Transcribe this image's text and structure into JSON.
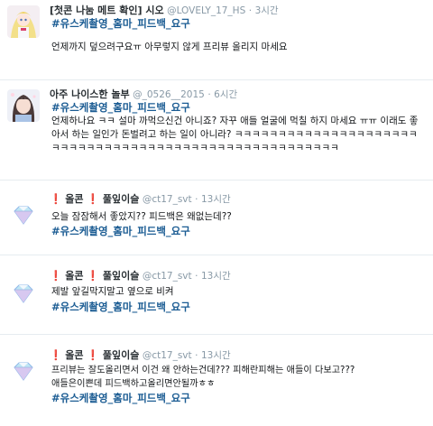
{
  "tweets": [
    {
      "name": "[첫콘 나눔 메트 확인] 시오",
      "handle": "@LOVELY_17_HS",
      "dot": "·",
      "time": "3시간",
      "hashtag": "#유스케촬영_홈마_피드백_요구",
      "text": "언제까지 덮으려구요ㅠ 아무렇지 않게 프리뷰 올리지 마세요"
    },
    {
      "name": "아주 나이스한 놀부",
      "handle": "@_0526__2015",
      "dot": "·",
      "time": "6시간",
      "hashtag": "#유스케촬영_홈마_피드백_요구",
      "text": "언제하나요 ㅋㅋ 설마 까먹으신건 아니죠? 자꾸 애들 얼굴에 먹칠 하지 마세요 ㅠㅠ 이래도 좋아서 하는 일인가 돈벌려고 하는 일이 아니라? ㅋㅋㅋㅋㅋㅋㅋㅋㅋㅋㅋㅋㅋㅋㅋㅋㅋㅋㅋㅋㅋㅋㅋㅋㅋㅋㅋㅋㅋㅋㅋㅋㅋㅋㅋㅋㅋㅋㅋㅋㅋㅋㅋㅋㅋㅋㅋㅋㅋㅋㅋㅋㅋㅋ"
    },
    {
      "name_mark": "❗",
      "name_a": "올콘",
      "name_b": "풀잎이슬",
      "handle": "@ct17_svt",
      "dot": "·",
      "time": "13시간",
      "hashtag": "#유스케촬영_홈마_피드백_요구",
      "text": "오늘 잠잠해서 좋았지?? 피드백은 왜없는데??"
    },
    {
      "name_mark": "❗",
      "name_a": "올콘",
      "name_b": "풀잎이슬",
      "handle": "@ct17_svt",
      "dot": "·",
      "time": "13시간",
      "hashtag": "#유스케촬영_홈마_피드백_요구",
      "text": "제발 앞길막지말고 옆으로 비켜"
    },
    {
      "name_mark": "❗",
      "name_a": "올콘",
      "name_b": "풀잎이슬",
      "handle": "@ct17_svt",
      "dot": "·",
      "time": "13시간",
      "text": "프리뷰는 잘도올리면서 이건 왜 안하는건데??? 피해란피해는 애들이 다보고???",
      "text2": "애들은이쁜데 피드백하고올리면안될까ㅎㅎ",
      "hashtag": "#유스케촬영_홈마_피드백_요구"
    }
  ]
}
